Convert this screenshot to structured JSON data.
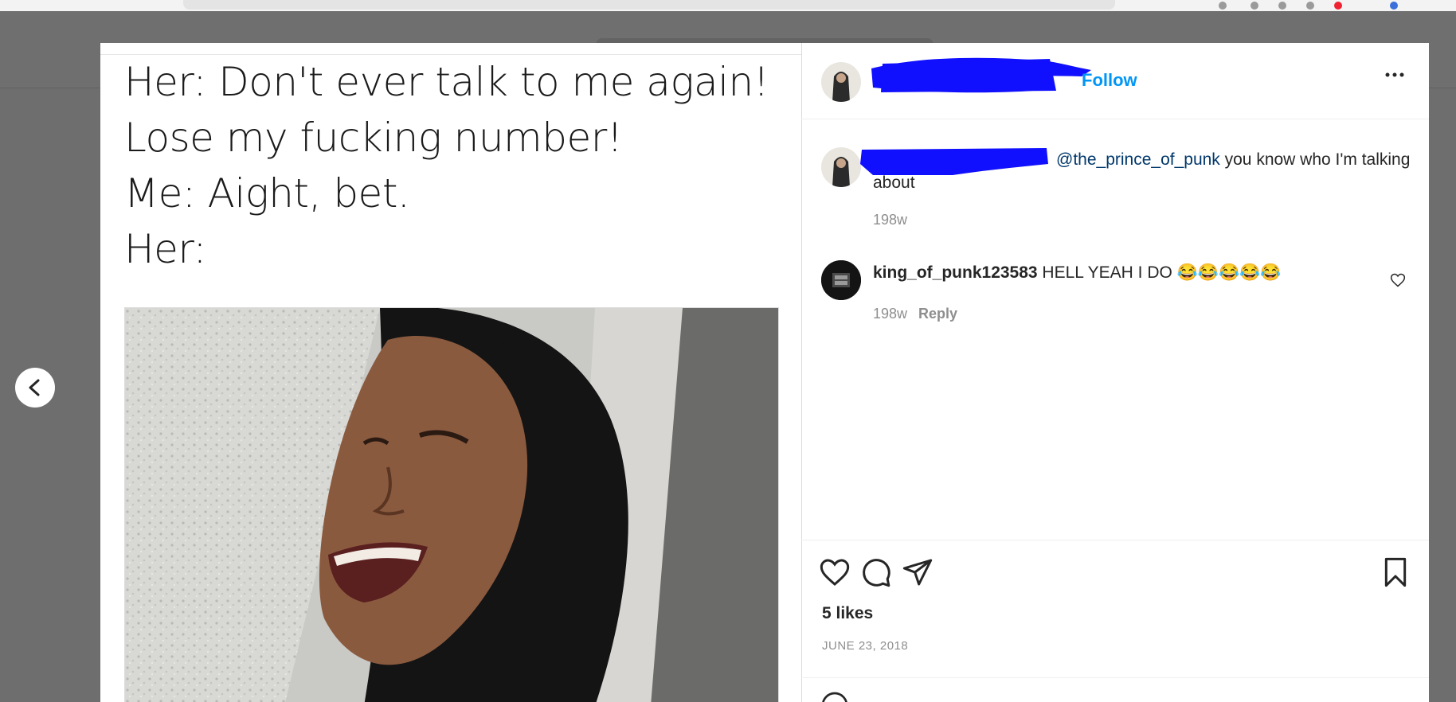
{
  "meme": {
    "lines": [
      "Her: Don't ever talk to me again!",
      "Lose my fucking number!",
      "Me: Aight, bet.",
      "Her:"
    ]
  },
  "header": {
    "follow_label": "Follow",
    "more_label": "···"
  },
  "caption": {
    "mention": "@the_prince_of_punk",
    "text": " you know who I'm talking about",
    "time": "198w"
  },
  "comment": {
    "username": "king_of_punk123583",
    "text": " HELL YEAH I DO 😂😂😂😂😂",
    "time": "198w",
    "reply_label": "Reply"
  },
  "likes": "5 likes",
  "date": "JUNE 23, 2018",
  "colors": {
    "link_blue": "#0095f6",
    "mention_blue": "#00376b",
    "redaction": "#1010ff",
    "backdrop": "#6e6e6e"
  },
  "icons": [
    "heart-icon",
    "comment-icon",
    "share-icon",
    "bookmark-icon",
    "more-icon",
    "chevron-left-icon"
  ]
}
